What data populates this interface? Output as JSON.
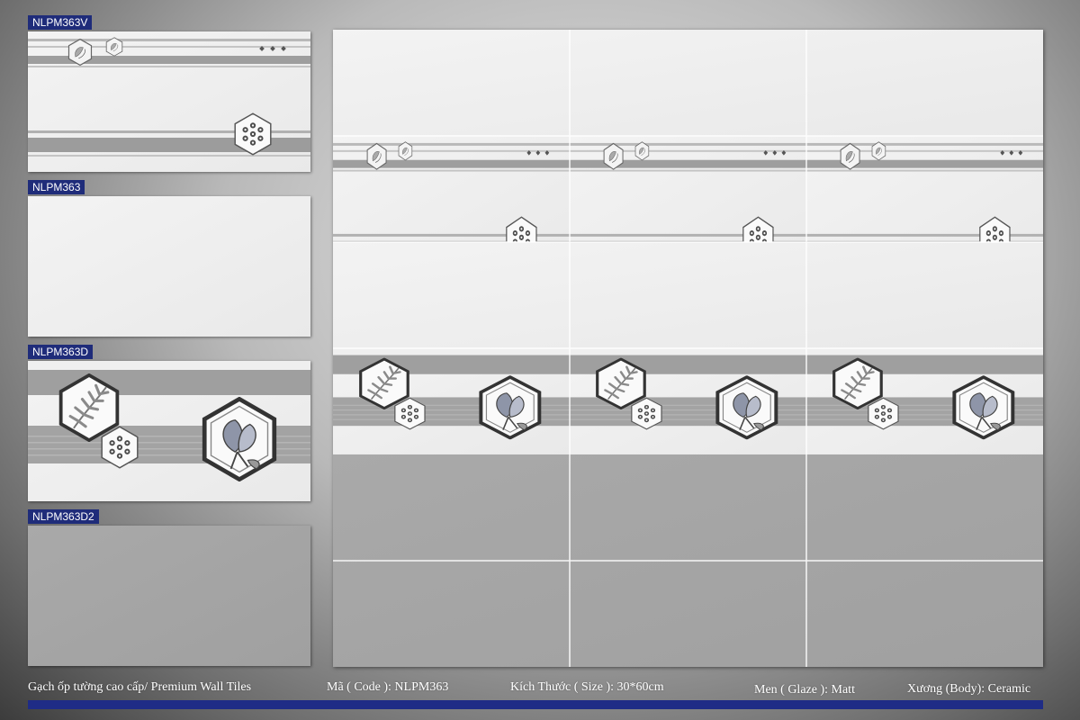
{
  "tiles": [
    {
      "code": "NLPM363V",
      "pattern": "hexagon-stripes-light"
    },
    {
      "code": "NLPM363",
      "pattern": "plain-white"
    },
    {
      "code": "NLPM363D",
      "pattern": "floral-hexagon-stripes"
    },
    {
      "code": "NLPM363D2",
      "pattern": "plain-grey"
    }
  ],
  "footer": {
    "title": "Gạch ốp tường cao cấp/ Premium Wall Tiles",
    "code": "Mã ( Code ): NLPM363",
    "size": "Kích Thước ( Size ): 30*60cm",
    "glaze": "Men ( Glaze ): Matt",
    "body": "Xương (Body): Ceramic"
  },
  "colors": {
    "label_bg": "#1f2c7a",
    "footer_bar": "#1f2c86",
    "tile_white": "#f1f1f1",
    "tile_grey": "#a6a6a6"
  }
}
